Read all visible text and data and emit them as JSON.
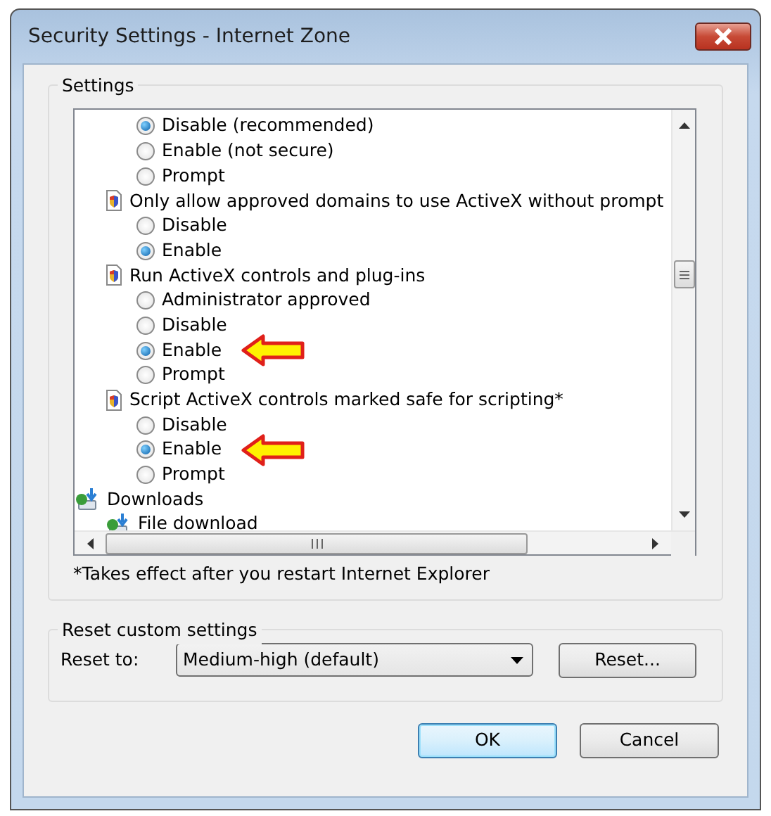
{
  "window": {
    "title": "Security Settings - Internet Zone"
  },
  "settings": {
    "title": "Settings",
    "list": [
      {
        "kind": "options",
        "options": [
          {
            "label": "Disable (recommended)",
            "selected": true,
            "highlighted": false
          },
          {
            "label": "Enable (not secure)",
            "selected": false,
            "highlighted": false
          },
          {
            "label": "Prompt",
            "selected": false,
            "highlighted": false
          }
        ]
      },
      {
        "kind": "setting",
        "label": "Only allow approved domains to use ActiveX without prompt",
        "options": [
          {
            "label": "Disable",
            "selected": false,
            "highlighted": false
          },
          {
            "label": "Enable",
            "selected": true,
            "highlighted": false
          }
        ]
      },
      {
        "kind": "setting",
        "label": "Run ActiveX controls and plug-ins",
        "options": [
          {
            "label": "Administrator approved",
            "selected": false,
            "highlighted": false
          },
          {
            "label": "Disable",
            "selected": false,
            "highlighted": false
          },
          {
            "label": "Enable",
            "selected": true,
            "highlighted": true
          },
          {
            "label": "Prompt",
            "selected": false,
            "highlighted": false
          }
        ]
      },
      {
        "kind": "setting",
        "label": "Script ActiveX controls marked safe for scripting*",
        "options": [
          {
            "label": "Disable",
            "selected": false,
            "highlighted": false
          },
          {
            "label": "Enable",
            "selected": true,
            "highlighted": true
          },
          {
            "label": "Prompt",
            "selected": false,
            "highlighted": false
          }
        ]
      },
      {
        "kind": "category",
        "label": "Downloads",
        "children": [
          {
            "kind": "category",
            "label": "File download"
          }
        ]
      }
    ],
    "note": "*Takes effect after you restart Internet Explorer"
  },
  "reset": {
    "title": "Reset custom settings",
    "label": "Reset to:",
    "value": "Medium-high (default)",
    "button": "Reset..."
  },
  "buttons": [
    {
      "label": "OK",
      "default": true
    },
    {
      "label": "Cancel",
      "default": false
    }
  ]
}
